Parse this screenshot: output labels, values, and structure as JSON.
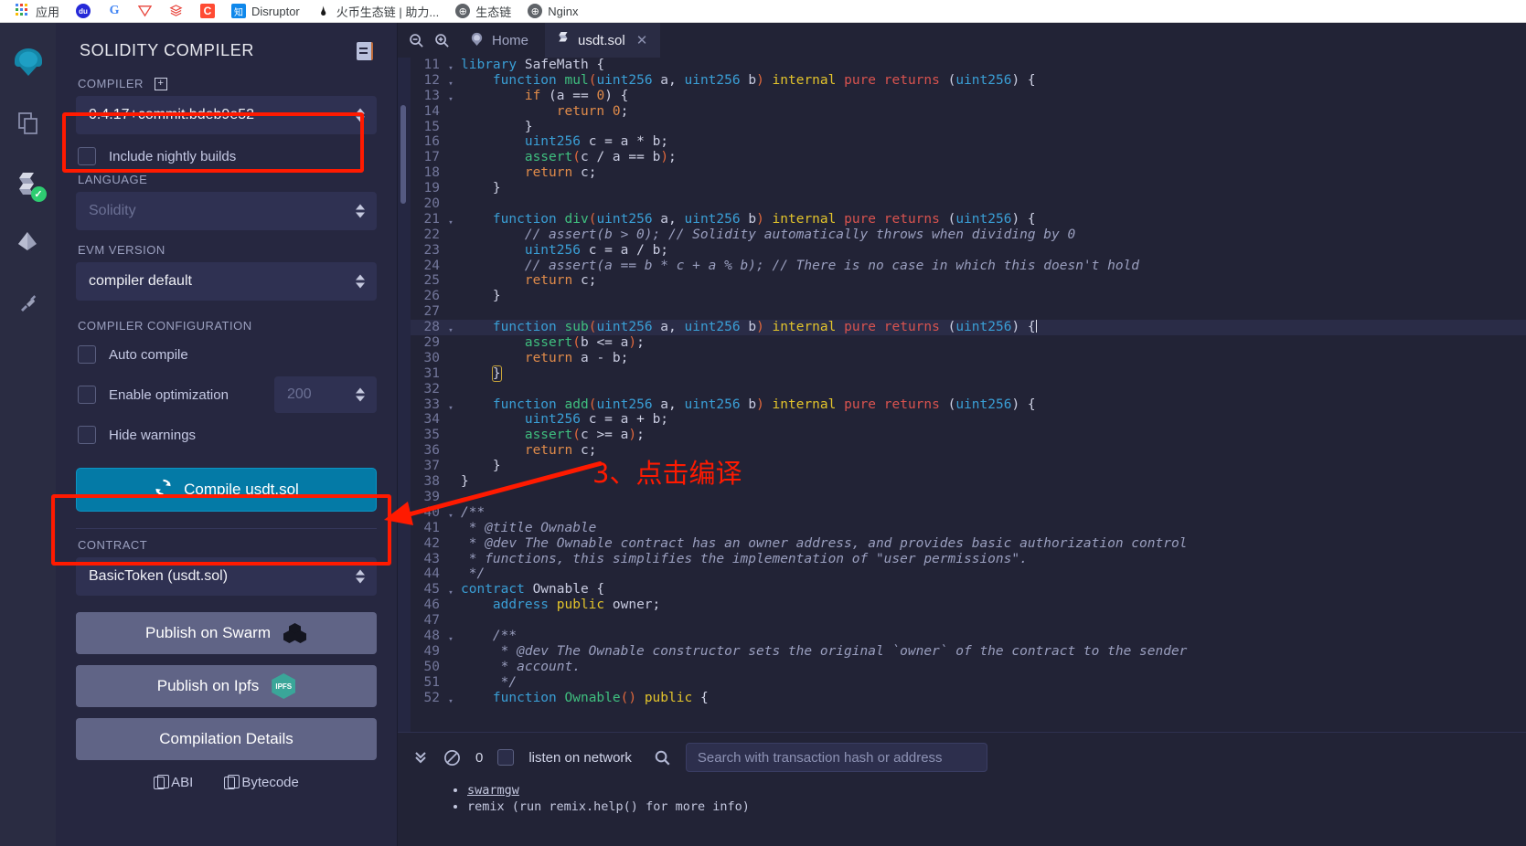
{
  "browser": {
    "bookmarks": [
      {
        "label": "应用",
        "icon": "apps-grid-icon"
      },
      {
        "label": "",
        "icon": "baidu-icon"
      },
      {
        "label": "",
        "icon": "google-icon"
      },
      {
        "label": "",
        "icon": "tron-icon"
      },
      {
        "label": "",
        "icon": "books-icon"
      },
      {
        "label": "",
        "icon": "c-square-icon"
      },
      {
        "label": "Disruptor",
        "icon": "zhihu-icon"
      },
      {
        "label": "火币生态链 | 助力...",
        "icon": "flame-icon"
      },
      {
        "label": "生态链",
        "icon": "globe-icon"
      },
      {
        "label": "Nginx",
        "icon": "globe-icon"
      }
    ]
  },
  "rail": {
    "items": [
      {
        "name": "remix-logo-icon",
        "label": "Remix"
      },
      {
        "name": "file-explorer-icon",
        "label": "File explorers"
      },
      {
        "name": "solidity-compiler-icon",
        "label": "Solidity compiler",
        "badge": "✓"
      },
      {
        "name": "deploy-run-icon",
        "label": "Deploy & run transactions"
      },
      {
        "name": "plugin-manager-icon",
        "label": "Plugin manager"
      }
    ]
  },
  "panel": {
    "title": "SOLIDITY COMPILER",
    "doc_icon": "document-icon",
    "compiler_label": "COMPILER",
    "compiler_value": "0.4.17+commit.bdeb9e52",
    "nightly_label": "Include nightly builds",
    "language_label": "LANGUAGE",
    "language_value": "Solidity",
    "evm_label": "EVM VERSION",
    "evm_value": "compiler default",
    "config_label": "COMPILER CONFIGURATION",
    "auto_compile_label": "Auto compile",
    "enable_opt_label": "Enable optimization",
    "runs_value": "200",
    "hide_warnings_label": "Hide warnings",
    "compile_label": "Compile usdt.sol",
    "contract_label": "CONTRACT",
    "contract_value": "BasicToken (usdt.sol)",
    "publish_swarm_label": "Publish on Swarm",
    "publish_ipfs_label": "Publish on Ipfs",
    "ipfs_badge": "IPFS",
    "details_label": "Compilation Details",
    "abi_label": "ABI",
    "bytecode_label": "Bytecode"
  },
  "tabs": {
    "zoom_out_icon": "zoom-out-icon",
    "zoom_in_icon": "zoom-in-icon",
    "home_label": "Home",
    "file_label": "usdt.sol",
    "close_icon": "close-icon"
  },
  "editor": {
    "active_line": 28,
    "first_line": 11,
    "lines": [
      {
        "n": 11,
        "fold": true,
        "html": "<span class=\"kw\">library</span> <span class=\"ident\">SafeMath</span> <span class=\"punct\">{</span>"
      },
      {
        "n": 12,
        "fold": true,
        "html": "    <span class=\"kw\">function</span> <span class=\"fn\">mul</span><span class=\"paren1\">(</span><span class=\"kw\">uint256</span> <span class=\"ident\">a</span><span class=\"punct\">,</span> <span class=\"kw\">uint256</span> <span class=\"ident\">b</span><span class=\"paren1\">)</span> <span class=\"kw2\">internal</span> <span class=\"kw3\">pure</span> <span class=\"kw3\">returns</span> <span class=\"punct\">(</span><span class=\"kw\">uint256</span><span class=\"punct\">)</span> <span class=\"punct\">{</span>"
      },
      {
        "n": 13,
        "fold": true,
        "html": "        <span class=\"ctl\">if</span> <span class=\"punct\">(</span><span class=\"ident\">a</span> <span class=\"punct\">==</span> <span class=\"num\">0</span><span class=\"punct\">)</span> <span class=\"punct\">{</span>"
      },
      {
        "n": 14,
        "fold": false,
        "html": "            <span class=\"ctl\">return</span> <span class=\"num\">0</span><span class=\"punct\">;</span>"
      },
      {
        "n": 15,
        "fold": false,
        "html": "        <span class=\"punct\">}</span>"
      },
      {
        "n": 16,
        "fold": false,
        "html": "        <span class=\"kw\">uint256</span> <span class=\"ident\">c</span> <span class=\"punct\">=</span> <span class=\"ident\">a</span> <span class=\"punct\">*</span> <span class=\"ident\">b</span><span class=\"punct\">;</span>"
      },
      {
        "n": 17,
        "fold": false,
        "html": "        <span class=\"fn\">assert</span><span class=\"paren1\">(</span><span class=\"ident\">c</span> <span class=\"punct\">/</span> <span class=\"ident\">a</span> <span class=\"punct\">==</span> <span class=\"ident\">b</span><span class=\"paren1\">)</span><span class=\"punct\">;</span>"
      },
      {
        "n": 18,
        "fold": false,
        "html": "        <span class=\"ctl\">return</span> <span class=\"ident\">c</span><span class=\"punct\">;</span>"
      },
      {
        "n": 19,
        "fold": false,
        "html": "    <span class=\"punct\">}</span>"
      },
      {
        "n": 20,
        "fold": false,
        "html": ""
      },
      {
        "n": 21,
        "fold": true,
        "html": "    <span class=\"kw\">function</span> <span class=\"fn\">div</span><span class=\"paren1\">(</span><span class=\"kw\">uint256</span> <span class=\"ident\">a</span><span class=\"punct\">,</span> <span class=\"kw\">uint256</span> <span class=\"ident\">b</span><span class=\"paren1\">)</span> <span class=\"kw2\">internal</span> <span class=\"kw3\">pure</span> <span class=\"kw3\">returns</span> <span class=\"punct\">(</span><span class=\"kw\">uint256</span><span class=\"punct\">)</span> <span class=\"punct\">{</span>"
      },
      {
        "n": 22,
        "fold": false,
        "html": "        <span class=\"cmt\">// assert(b &gt; 0); // Solidity automatically throws when dividing by 0</span>"
      },
      {
        "n": 23,
        "fold": false,
        "html": "        <span class=\"kw\">uint256</span> <span class=\"ident\">c</span> <span class=\"punct\">=</span> <span class=\"ident\">a</span> <span class=\"punct\">/</span> <span class=\"ident\">b</span><span class=\"punct\">;</span>"
      },
      {
        "n": 24,
        "fold": false,
        "html": "        <span class=\"cmt\">// assert(a == b * c + a % b); // There is no case in which this doesn't hold</span>"
      },
      {
        "n": 25,
        "fold": false,
        "html": "        <span class=\"ctl\">return</span> <span class=\"ident\">c</span><span class=\"punct\">;</span>"
      },
      {
        "n": 26,
        "fold": false,
        "html": "    <span class=\"punct\">}</span>"
      },
      {
        "n": 27,
        "fold": false,
        "html": ""
      },
      {
        "n": 28,
        "fold": true,
        "html": "    <span class=\"kw\">function</span> <span class=\"fn\">sub</span><span class=\"paren1\">(</span><span class=\"kw\">uint256</span> <span class=\"ident\">a</span><span class=\"punct\">,</span> <span class=\"kw\">uint256</span> <span class=\"ident\">b</span><span class=\"paren1\">)</span> <span class=\"kw2\">internal</span> <span class=\"kw3\">pure</span> <span class=\"kw3\">returns</span> <span class=\"punct\">(</span><span class=\"kw\">uint256</span><span class=\"punct\">)</span> <span class=\"punct\">{</span><span class=\"cursor\"></span>"
      },
      {
        "n": 29,
        "fold": false,
        "html": "        <span class=\"fn\">assert</span><span class=\"paren1\">(</span><span class=\"ident\">b</span> <span class=\"punct\">&lt;=</span> <span class=\"ident\">a</span><span class=\"paren1\">)</span><span class=\"punct\">;</span>"
      },
      {
        "n": 30,
        "fold": false,
        "html": "        <span class=\"ctl\">return</span> <span class=\"ident\">a</span> <span class=\"punct\">-</span> <span class=\"ident\">b</span><span class=\"punct\">;</span>"
      },
      {
        "n": 31,
        "fold": false,
        "html": "    <span class=\"punct brkt-match\">}</span>"
      },
      {
        "n": 32,
        "fold": false,
        "html": ""
      },
      {
        "n": 33,
        "fold": true,
        "html": "    <span class=\"kw\">function</span> <span class=\"fn\">add</span><span class=\"paren1\">(</span><span class=\"kw\">uint256</span> <span class=\"ident\">a</span><span class=\"punct\">,</span> <span class=\"kw\">uint256</span> <span class=\"ident\">b</span><span class=\"paren1\">)</span> <span class=\"kw2\">internal</span> <span class=\"kw3\">pure</span> <span class=\"kw3\">returns</span> <span class=\"punct\">(</span><span class=\"kw\">uint256</span><span class=\"punct\">)</span> <span class=\"punct\">{</span>"
      },
      {
        "n": 34,
        "fold": false,
        "html": "        <span class=\"kw\">uint256</span> <span class=\"ident\">c</span> <span class=\"punct\">=</span> <span class=\"ident\">a</span> <span class=\"punct\">+</span> <span class=\"ident\">b</span><span class=\"punct\">;</span>"
      },
      {
        "n": 35,
        "fold": false,
        "html": "        <span class=\"fn\">assert</span><span class=\"paren1\">(</span><span class=\"ident\">c</span> <span class=\"punct\">&gt;=</span> <span class=\"ident\">a</span><span class=\"paren1\">)</span><span class=\"punct\">;</span>"
      },
      {
        "n": 36,
        "fold": false,
        "html": "        <span class=\"ctl\">return</span> <span class=\"ident\">c</span><span class=\"punct\">;</span>"
      },
      {
        "n": 37,
        "fold": false,
        "html": "    <span class=\"punct\">}</span>"
      },
      {
        "n": 38,
        "fold": false,
        "html": "<span class=\"punct\">}</span>"
      },
      {
        "n": 39,
        "fold": false,
        "html": ""
      },
      {
        "n": 40,
        "fold": true,
        "html": "<span class=\"cmt\">/**</span>"
      },
      {
        "n": 41,
        "fold": false,
        "html": " <span class=\"cmt\">* @title Ownable</span>"
      },
      {
        "n": 42,
        "fold": false,
        "html": " <span class=\"cmt\">* @dev The Ownable contract has an owner address, and provides basic authorization control</span>"
      },
      {
        "n": 43,
        "fold": false,
        "html": " <span class=\"cmt\">* functions, this simplifies the implementation of \"user permissions\".</span>"
      },
      {
        "n": 44,
        "fold": false,
        "html": " <span class=\"cmt\">*/</span>"
      },
      {
        "n": 45,
        "fold": true,
        "html": "<span class=\"kw\">contract</span> <span class=\"ident\">Ownable</span> <span class=\"punct\">{</span>"
      },
      {
        "n": 46,
        "fold": false,
        "html": "    <span class=\"kw\">address</span> <span class=\"kw2\">public</span> <span class=\"ident\">owner</span><span class=\"punct\">;</span>"
      },
      {
        "n": 47,
        "fold": false,
        "html": ""
      },
      {
        "n": 48,
        "fold": true,
        "html": "    <span class=\"cmt\">/**</span>"
      },
      {
        "n": 49,
        "fold": false,
        "html": "     <span class=\"cmt\">* @dev The Ownable constructor sets the original `owner` of the contract to the sender</span>"
      },
      {
        "n": 50,
        "fold": false,
        "html": "     <span class=\"cmt\">* account.</span>"
      },
      {
        "n": 51,
        "fold": false,
        "html": "     <span class=\"cmt\">*/</span>"
      },
      {
        "n": 52,
        "fold": true,
        "html": "    <span class=\"kw\">function</span> <span class=\"fn\">Ownable</span><span class=\"paren1\">(</span><span class=\"paren1\">)</span> <span class=\"kw2\">public</span> <span class=\"punct\">{</span>"
      }
    ]
  },
  "terminal": {
    "collapse_icon": "chevrons-down-icon",
    "clear_icon": "no-entry-icon",
    "pending_count": "0",
    "listen_label": "listen on network",
    "search_icon": "search-icon",
    "search_placeholder": "Search with transaction hash or address",
    "log_lines": [
      "swarmgw",
      "remix (run remix.help() for more info)"
    ]
  },
  "annotation": {
    "text": "3、点击编译",
    "color": "#ff1a00"
  }
}
